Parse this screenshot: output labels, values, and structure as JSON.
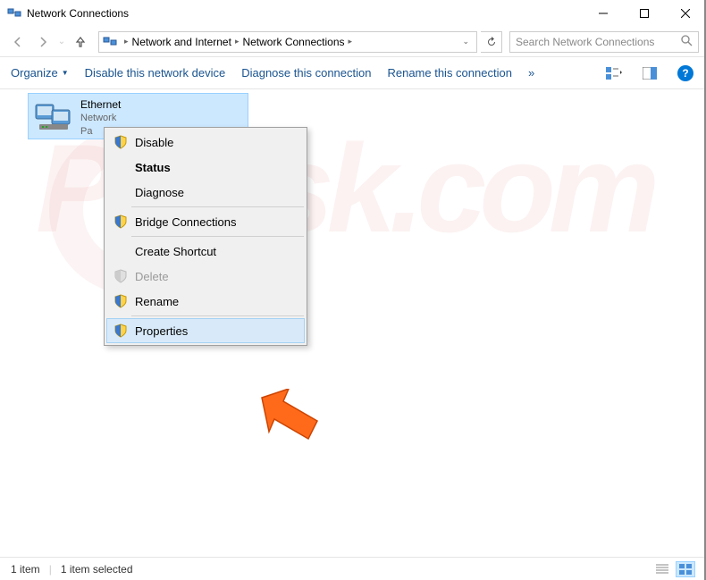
{
  "window": {
    "title": "Network Connections"
  },
  "nav": {
    "breadcrumb": [
      "Network and Internet",
      "Network Connections"
    ],
    "search_placeholder": "Search Network Connections"
  },
  "toolbar": {
    "organize": "Organize",
    "disable": "Disable this network device",
    "diagnose": "Diagnose this connection",
    "rename": "Rename this connection",
    "more": "»"
  },
  "adapter": {
    "name": "Ethernet",
    "status": "Network",
    "desc": "Pa"
  },
  "context_menu": {
    "disable": "Disable",
    "status": "Status",
    "diagnose": "Diagnose",
    "bridge": "Bridge Connections",
    "shortcut": "Create Shortcut",
    "delete": "Delete",
    "rename": "Rename",
    "properties": "Properties"
  },
  "statusbar": {
    "count": "1 item",
    "selected": "1 item selected"
  }
}
